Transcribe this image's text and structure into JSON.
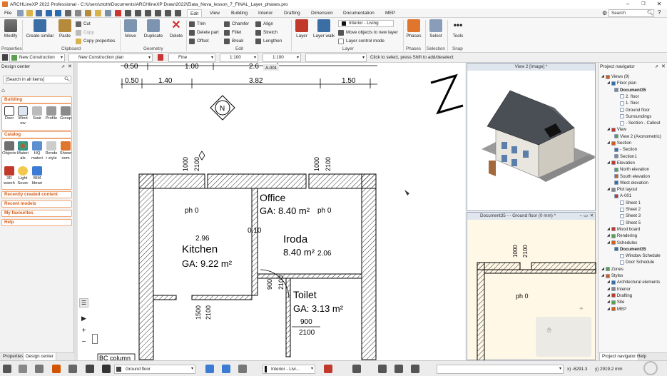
{
  "titlebar": {
    "title": "ARCHLineXP 2022  Professional - C:\\Users\\ztoth\\Documents\\ARCHlineXP Draw\\2022\\Elata_Nova_lesson_7_FINAL_Layer_phases.pro",
    "minimize": "–",
    "maximize": "❐",
    "close": "✕"
  },
  "menu": {
    "file": "File",
    "tabs": [
      "Edit",
      "View",
      "Building",
      "Interior",
      "Drafting",
      "Dimension",
      "Documentation",
      "MEP"
    ],
    "search_placeholder": "Search"
  },
  "ribbon": {
    "properties": {
      "modify": "Modify",
      "group": "Properties"
    },
    "clipboard": {
      "create_similar": "Create similar",
      "paste": "Paste",
      "cut": "Cut",
      "copy": "Copy",
      "copy_properties": "Copy properties",
      "group": "Clipboard"
    },
    "geometry": {
      "move": "Move",
      "duplicate": "Duplicate",
      "delete": "Delete",
      "group": "Geometry"
    },
    "edit": {
      "trim": "Trim",
      "chamfer": "Chamfer",
      "align": "Align",
      "delete_part": "Delete part",
      "fillet": "Fillet",
      "stretch": "Stretch",
      "offset": "Offset",
      "break": "Break",
      "lengthen": "Lengthen",
      "group": "Edit"
    },
    "layer": {
      "layer": "Layer",
      "layer_walk": "Layer walk",
      "current_layer": "Interior - Living",
      "move_objects": "Move objects to new layer",
      "layer_control": "Layer control mode",
      "group": "Layer"
    },
    "phases": {
      "phases": "Phases",
      "group": "Phases"
    },
    "selection": {
      "select": "Select",
      "group": "Selection"
    },
    "snap": {
      "tools": "Tools",
      "group": "Snap"
    }
  },
  "optionbar": {
    "construction": "New Construction",
    "construction_plan": "New Construction plan",
    "linetype": "Fine",
    "scale1": "1:100",
    "scale2": "1:100",
    "hint": "Click to select, press Shift to add/deselect"
  },
  "design_center": {
    "title": "Design center",
    "search_placeholder": "[Search in all items]",
    "building": {
      "title": "Building",
      "items": [
        "Door",
        "Wind ow",
        "Stair",
        "Profile",
        "Group"
      ]
    },
    "catalog": {
      "title": "Catalog",
      "items": [
        "Objects",
        "Materi als",
        "HQ materi",
        "Rende r style",
        "Showr oom",
        "3D wareh",
        "Light Sourc",
        "BIM librari"
      ]
    },
    "links": [
      "Recently created content",
      "Recent models",
      "My favourites",
      "Help"
    ],
    "tabs": [
      "Properties",
      "Design center"
    ]
  },
  "drawing": {
    "dims_top": [
      "0.50",
      "1.40",
      "3.82",
      "1.50",
      "0.50",
      "1.00",
      "2.6"
    ],
    "sheet_label": "A-001",
    "north": "N",
    "dims_side": [
      "1000",
      "2100",
      "1000",
      "2100"
    ],
    "rooms": [
      {
        "name": "Office",
        "area": "GA: 8.40 m²"
      },
      {
        "name": "Kitchen",
        "area": "GA: 9.22 m²"
      },
      {
        "name": "Iroda",
        "area": "8.40 m²"
      },
      {
        "name": "Toilet",
        "area": "GA: 3.13 m²"
      }
    ],
    "labels": [
      "ph 0",
      "ph 0",
      "2.96",
      "2.06",
      "0.10",
      "900",
      "2100",
      "1500",
      "2100",
      "900",
      "2100"
    ],
    "bottom": "BC column"
  },
  "view2": {
    "title": "View 2 [Image] *"
  },
  "view3": {
    "title": "Document35 -  - Ground floor (0 mm) *",
    "dims": [
      "1000",
      "2100"
    ],
    "label": "ph 0"
  },
  "navigator": {
    "title": "Project navigator",
    "items": [
      {
        "label": "Views (9)",
        "indent": 0
      },
      {
        "label": "Floor plan",
        "indent": 1
      },
      {
        "label": "Document35",
        "indent": 2
      },
      {
        "label": "2. floor",
        "indent": 3
      },
      {
        "label": "1. floor",
        "indent": 3
      },
      {
        "label": "Ground floor",
        "indent": 3
      },
      {
        "label": "Surroundings",
        "indent": 3
      },
      {
        "label": "- Section - Callout",
        "indent": 3
      },
      {
        "label": "View",
        "indent": 1
      },
      {
        "label": "View 2 (Axonometric)",
        "indent": 2
      },
      {
        "label": "Section",
        "indent": 1
      },
      {
        "label": "- Section",
        "indent": 2
      },
      {
        "label": "Section1",
        "indent": 2
      },
      {
        "label": "Elevation",
        "indent": 1
      },
      {
        "label": "North elevation",
        "indent": 2
      },
      {
        "label": "South elevation",
        "indent": 2
      },
      {
        "label": "West elevation",
        "indent": 2
      },
      {
        "label": "Plot layout",
        "indent": 1
      },
      {
        "label": "A-001",
        "indent": 2
      },
      {
        "label": "Sheet 1",
        "indent": 3
      },
      {
        "label": "Sheet 2",
        "indent": 3
      },
      {
        "label": "Sheet 3",
        "indent": 3
      },
      {
        "label": "Sheet 5",
        "indent": 3
      },
      {
        "label": "Mood board",
        "indent": 1
      },
      {
        "label": "Rendering",
        "indent": 1
      },
      {
        "label": "Schedules",
        "indent": 1
      },
      {
        "label": "Document35",
        "indent": 2
      },
      {
        "label": "Window Schedule",
        "indent": 3
      },
      {
        "label": "Door Schedule",
        "indent": 3
      },
      {
        "label": "Zones",
        "indent": 0
      },
      {
        "label": "Styles",
        "indent": 0
      },
      {
        "label": "Architectural elements",
        "indent": 1
      },
      {
        "label": "Interior",
        "indent": 1
      },
      {
        "label": "Drafting",
        "indent": 1
      },
      {
        "label": "Site",
        "indent": 1
      },
      {
        "label": "MEP",
        "indent": 1
      }
    ],
    "tabs": [
      "Project navigator",
      "Help"
    ]
  },
  "statusbar": {
    "floor": "Ground floor",
    "layer": "Interior - Livi...",
    "x": "x) -6291.3",
    "y": "y) 2919.2 mm"
  },
  "colors": {
    "accent": "#d45d18",
    "ribbon_blue": "#3b6ea5",
    "layer_red": "#c0392b"
  }
}
